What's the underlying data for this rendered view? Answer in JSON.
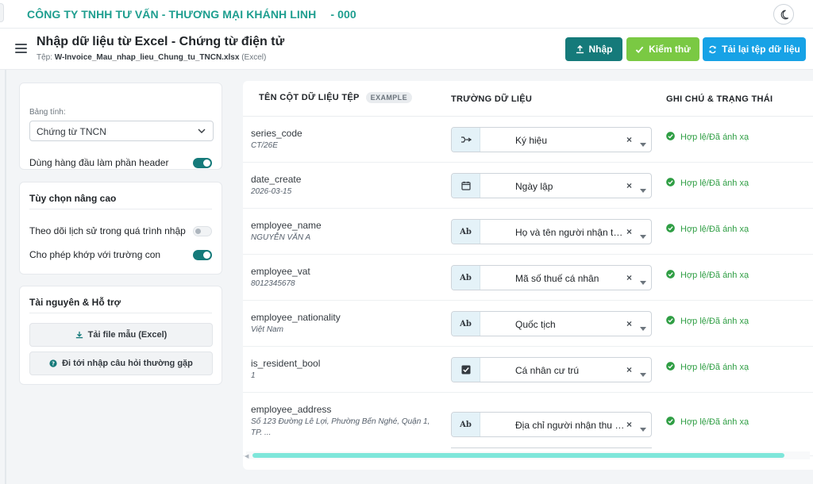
{
  "topbar": {
    "company": "CÔNG TY TNHH TƯ VẤN - THƯƠNG MẠI KHÁNH LINH",
    "code": "- 000",
    "theme_icon": "moon-icon"
  },
  "header": {
    "title": "Nhập dữ liệu từ Excel - Chứng từ điện tử",
    "file_prefix": "Tệp:",
    "file_name": "W-Invoice_Mau_nhap_lieu_Chung_tu_TNCN.xlsx",
    "file_type": "(Excel)",
    "buttons": {
      "import": "Nhập",
      "test": "Kiểm thử",
      "reload": "Tải lại tệp dữ liệu"
    }
  },
  "sidebar": {
    "sheet_label": "Bảng tính:",
    "sheet_value": "Chứng từ TNCN",
    "first_row_header": {
      "label": "Dùng hàng đầu làm phần header",
      "on": true
    },
    "advanced": {
      "title": "Tùy chọn nâng cao",
      "track_history": {
        "label": "Theo dõi lịch sử trong quá trình nhập",
        "on": false
      },
      "match_child": {
        "label": "Cho phép khớp với trường con",
        "on": true
      }
    },
    "resources": {
      "title": "Tài nguyên & Hỗ trợ",
      "download_template": "Tải file mẫu (Excel)",
      "faq": "Đi tới nhập câu hỏi thường gặp"
    }
  },
  "table": {
    "headers": {
      "source_column": "TÊN CỘT DỮ LIỆU TỆP",
      "example_badge": "EXAMPLE",
      "data_field": "TRƯỜNG DỮ LIỆU",
      "notes_status": "GHI CHÚ & TRẠNG THÁI"
    },
    "status_color": "#2f9e44",
    "rows": [
      {
        "column": "series_code",
        "example": "CT/26E",
        "field": "Ký hiệu",
        "icon": "code-icon",
        "status": "Hợp lệ/Đã ánh xạ"
      },
      {
        "column": "date_create",
        "example": "2026-03-15",
        "field": "Ngày lập",
        "icon": "calendar-icon",
        "status": "Hợp lệ/Đã ánh xạ"
      },
      {
        "column": "employee_name",
        "example": "NGUYỄN VĂN A",
        "field": "Họ và tên người nhận thu nhập",
        "icon": "text-icon",
        "icon_text": "Ab",
        "status": "Hợp lệ/Đã ánh xạ"
      },
      {
        "column": "employee_vat",
        "example": "8012345678",
        "field": "Mã số thuế cá nhân",
        "icon": "text-icon",
        "icon_text": "Ab",
        "status": "Hợp lệ/Đã ánh xạ"
      },
      {
        "column": "employee_nationality",
        "example": "Việt Nam",
        "field": "Quốc tịch",
        "icon": "text-icon",
        "icon_text": "Ab",
        "status": "Hợp lệ/Đã ánh xạ"
      },
      {
        "column": "is_resident_bool",
        "example": "1",
        "field": "Cá nhân cư trú",
        "icon": "checkbox-icon",
        "status": "Hợp lệ/Đã ánh xạ"
      },
      {
        "column": "employee_address",
        "example": "Số 123 Đường Lê Lợi, Phường Bến Nghé, Quận 1, TP. ...",
        "field": "Địa chỉ người nhận thu nhập",
        "icon": "text-icon",
        "icon_text": "Ab",
        "status": "Hợp lệ/Đã ánh xạ"
      }
    ]
  }
}
